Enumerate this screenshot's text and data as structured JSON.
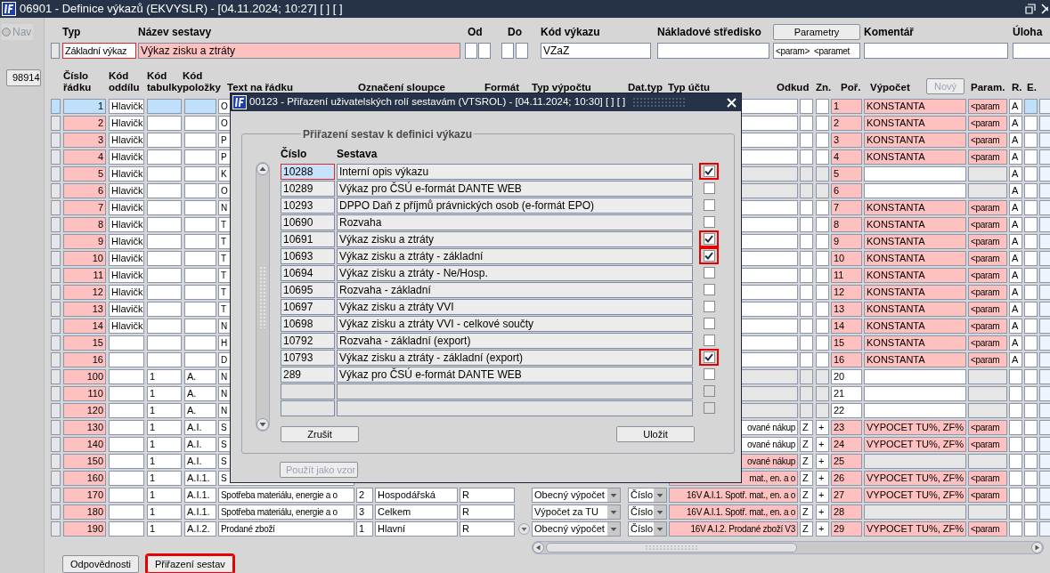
{
  "window": {
    "title": "06901 - Definice výkazů (EKVYSLR) - [04.11.2024; 10:27] [ ] [ ]"
  },
  "sidebar": {
    "nav": {
      "label": "Nav",
      "disabled": true
    },
    "record": "98914"
  },
  "form": {
    "typ": {
      "label": "Typ",
      "value": "Základní výkaz",
      "highlighted": true
    },
    "nazev": {
      "label": "Název sestavy",
      "value": "Výkaz zisku a ztráty"
    },
    "od": {
      "label": "Od"
    },
    "do": {
      "label": "Do"
    },
    "kod": {
      "label": "Kód výkazu",
      "value": "VZaZ"
    },
    "stredisko": {
      "label": "Nákladové středisko"
    },
    "parametry": {
      "button": "Parametry",
      "value": "<param>  <paramet"
    },
    "komentar": {
      "label": "Komentář"
    },
    "uloha": {
      "label": "Úloha"
    }
  },
  "table": {
    "columns": [
      "Číslo řádku",
      "Kód oddílu",
      "Kód tabulky",
      "Kód položky",
      "Text na řádku",
      "Označení sloupce",
      "Formát",
      "Typ výpočtu",
      "Dat.typ",
      "Typ účtu",
      "Odkud",
      "Zn.",
      "Poř.",
      "Výpočet",
      "Param.",
      "R.",
      "E."
    ],
    "new_button": {
      "label": "Nový",
      "disabled": true
    },
    "rows": [
      {
        "cislo": "1",
        "oddil": "Hlavičk",
        "text": "O",
        "por": "1",
        "vypocet": "KONSTANTA",
        "param": "<param",
        "r": "A",
        "selected": true,
        "disabled": false,
        "por_invalid": true,
        "uctu_invalid": false
      },
      {
        "cislo": "2",
        "oddil": "Hlavičk",
        "text": "O",
        "por": "2",
        "vypocet": "KONSTANTA",
        "param": "<param",
        "r": "A",
        "selected": false,
        "disabled": false,
        "por_invalid": true,
        "uctu_invalid": false
      },
      {
        "cislo": "3",
        "oddil": "Hlavičk",
        "text": "P",
        "por": "3",
        "vypocet": "KONSTANTA",
        "param": "<param",
        "r": "A",
        "selected": false,
        "disabled": false,
        "por_invalid": true,
        "uctu_invalid": false
      },
      {
        "cislo": "4",
        "oddil": "Hlavičk",
        "text": "P",
        "por": "4",
        "vypocet": "KONSTANTA",
        "param": "<param",
        "r": "A",
        "selected": false,
        "disabled": false,
        "por_invalid": true,
        "uctu_invalid": false
      },
      {
        "cislo": "5",
        "oddil": "Hlavičk",
        "text": "K",
        "por": "5",
        "r": "A",
        "selected": false,
        "disabled": true,
        "por_invalid": true
      },
      {
        "cislo": "6",
        "oddil": "Hlavičk",
        "text": "O",
        "por": "6",
        "r": "A",
        "selected": false,
        "disabled": true,
        "por_invalid": true
      },
      {
        "cislo": "7",
        "oddil": "Hlavičk",
        "text": "N",
        "por": "7",
        "vypocet": "KONSTANTA",
        "param": "<param",
        "r": "A",
        "selected": false,
        "disabled": false,
        "por_invalid": true,
        "uctu_invalid": false
      },
      {
        "cislo": "8",
        "oddil": "Hlavičk",
        "text": "T",
        "por": "8",
        "vypocet": "KONSTANTA",
        "param": "<param",
        "r": "A",
        "selected": false,
        "disabled": false,
        "por_invalid": true,
        "uctu_invalid": false
      },
      {
        "cislo": "9",
        "oddil": "Hlavičk",
        "text": "T",
        "por": "9",
        "vypocet": "KONSTANTA",
        "param": "<param",
        "r": "A",
        "selected": false,
        "disabled": false,
        "por_invalid": true,
        "uctu_invalid": false
      },
      {
        "cislo": "10",
        "oddil": "Hlavičk",
        "text": "T",
        "por": "10",
        "vypocet": "KONSTANTA",
        "param": "<param",
        "r": "A",
        "selected": false,
        "disabled": false,
        "por_invalid": true,
        "uctu_invalid": false
      },
      {
        "cislo": "11",
        "oddil": "Hlavičk",
        "text": "T",
        "por": "11",
        "vypocet": "KONSTANTA",
        "param": "<param",
        "r": "A",
        "selected": false,
        "disabled": false,
        "por_invalid": true,
        "uctu_invalid": false
      },
      {
        "cislo": "12",
        "oddil": "Hlavičk",
        "text": "T",
        "por": "12",
        "vypocet": "KONSTANTA",
        "param": "<param",
        "r": "A",
        "selected": false,
        "disabled": false,
        "por_invalid": true,
        "uctu_invalid": false
      },
      {
        "cislo": "13",
        "oddil": "Hlavičk",
        "text": "T",
        "por": "13",
        "vypocet": "KONSTANTA",
        "param": "<param",
        "r": "A",
        "selected": false,
        "disabled": false,
        "por_invalid": true,
        "uctu_invalid": false
      },
      {
        "cislo": "14",
        "oddil": "Hlavičk",
        "text": "N",
        "por": "14",
        "vypocet": "KONSTANTA",
        "param": "<param",
        "r": "A",
        "selected": false,
        "disabled": false,
        "por_invalid": true,
        "uctu_invalid": false
      },
      {
        "cislo": "15",
        "text": "H",
        "por": "15",
        "vypocet": "KONSTANTA",
        "param": "<param",
        "r": "A",
        "selected": false,
        "disabled": false,
        "por_invalid": true,
        "uctu_invalid": false
      },
      {
        "cislo": "16",
        "text": "D",
        "por": "16",
        "vypocet": "KONSTANTA",
        "param": "<param",
        "r": "A",
        "selected": false,
        "disabled": false,
        "por_invalid": true,
        "uctu_invalid": false
      },
      {
        "cislo": "100",
        "tabulka": "1",
        "polozka": "A.",
        "text": "N",
        "por": "20",
        "selected": false,
        "disabled": true,
        "por_invalid": false
      },
      {
        "cislo": "110",
        "tabulka": "1",
        "polozka": "A.",
        "text": "N",
        "por": "21",
        "selected": false,
        "disabled": true,
        "por_invalid": false
      },
      {
        "cislo": "120",
        "tabulka": "1",
        "polozka": "A.",
        "text": "N",
        "por": "22",
        "selected": false,
        "disabled": true,
        "por_invalid": false
      },
      {
        "cislo": "130",
        "tabulka": "1",
        "polozka": "A.I.",
        "text": "S",
        "typ_uctu": "ované nákup",
        "odkud": "Z",
        "zn": "+",
        "por": "23",
        "vypocet": "VYPOCET TU%, ZF%",
        "param": "<param",
        "selected": false,
        "disabled": false,
        "por_invalid": true,
        "uctu_invalid": false
      },
      {
        "cislo": "140",
        "tabulka": "1",
        "polozka": "A.I.",
        "text": "S",
        "typ_uctu": "ované nákup",
        "odkud": "Z",
        "zn": "+",
        "por": "24",
        "vypocet": "VYPOCET TU%, ZF%",
        "param": "<param",
        "selected": false,
        "disabled": false,
        "por_invalid": true,
        "uctu_invalid": false
      },
      {
        "cislo": "150",
        "tabulka": "1",
        "polozka": "A.I.",
        "text": "S",
        "typ_uctu": "ované nákup",
        "odkud": "Z",
        "zn": "+",
        "por": "25",
        "selected": false,
        "disabled": false,
        "por_invalid": true,
        "uctu_invalid": true
      },
      {
        "cislo": "160",
        "tabulka": "1",
        "polozka": "A.I.1.",
        "text": "S",
        "typ_uctu": "mat., en. a o",
        "odkud": "Z",
        "zn": "+",
        "por": "26",
        "vypocet": "VYPOCET TU%, ZF%",
        "param": "<param",
        "selected": false,
        "disabled": false,
        "por_invalid": true,
        "uctu_invalid": true
      },
      {
        "cislo": "170",
        "tabulka": "1",
        "polozka": "A.I.1.",
        "text": "Spotřeba materiálu, energie a o",
        "sloupec": "2",
        "sloupec_nazev": "Hospodářská",
        "format": "R",
        "typ_vypoctu": "Obecný výpočet",
        "dat_typ": "Číslo",
        "typ_uctu": "16V A.I.1. Spotř. mat., en. a o",
        "odkud": "Z",
        "zn": "+",
        "por": "27",
        "vypocet": "VYPOCET TU%, ZF%",
        "param": "<param",
        "selected": false,
        "disabled": false,
        "por_invalid": true,
        "uctu_invalid": true
      },
      {
        "cislo": "180",
        "tabulka": "1",
        "polozka": "A.I.1.",
        "text": "Spotřeba materiálu, energie a o",
        "sloupec": "3",
        "sloupec_nazev": "Celkem",
        "format": "R",
        "typ_vypoctu": "Výpočet za TU",
        "dat_typ": "Číslo",
        "typ_uctu": "16V A.I.1. Spotř. mat., en. a o",
        "odkud": "Z",
        "zn": "+",
        "por": "28",
        "selected": false,
        "disabled": false,
        "por_invalid": true,
        "uctu_invalid": true
      },
      {
        "cislo": "190",
        "tabulka": "1",
        "polozka": "A.I.2.",
        "text": "Prodané zboží",
        "sloupec": "1",
        "sloupec_nazev": "Hlavní",
        "format": "R",
        "typ_vypoctu": "Obecný výpočet",
        "dat_typ": "Číslo",
        "typ_uctu": "16V A.I.2. Prodané zboží V3",
        "odkud": "Z",
        "zn": "+",
        "por": "29",
        "vypocet": "VYPOCET TU%, ZF%",
        "param": "<param",
        "selected": false,
        "disabled": false,
        "por_invalid": true,
        "uctu_invalid": true
      }
    ]
  },
  "dialog": {
    "title": "00123 - Přiřazení uživatelských rolí sestavám (VTSROL) - [04.11.2024; 10:30] [ ] [ ]",
    "group": "Přiřazení sestav k definici výkazu",
    "columns": [
      "Číslo",
      "Sestava"
    ],
    "rows": [
      {
        "cislo": "10288",
        "sestava": "Interní opis výkazu",
        "checked": true,
        "selected": true,
        "disabled": false
      },
      {
        "cislo": "10289",
        "sestava": "Výkaz pro ČSÚ e-formát DANTE WEB",
        "checked": false,
        "selected": false,
        "disabled": false
      },
      {
        "cislo": "10293",
        "sestava": "DPPO Daň z příjmů právnických osob (e-formát EPO)",
        "checked": false,
        "selected": false,
        "disabled": false
      },
      {
        "cislo": "10690",
        "sestava": "Rozvaha",
        "checked": false,
        "selected": false,
        "disabled": false
      },
      {
        "cislo": "10691",
        "sestava": "Výkaz zisku a ztráty",
        "checked": true,
        "selected": false,
        "disabled": false
      },
      {
        "cislo": "10693",
        "sestava": "Výkaz zisku a ztráty - základní",
        "checked": true,
        "selected": false,
        "disabled": false
      },
      {
        "cislo": "10694",
        "sestava": "Výkaz zisku a ztráty - Ne/Hosp.",
        "checked": false,
        "selected": false,
        "disabled": false
      },
      {
        "cislo": "10695",
        "sestava": "Rozvaha - základní",
        "checked": false,
        "selected": false,
        "disabled": false
      },
      {
        "cislo": "10697",
        "sestava": "Výkaz zisku a ztráty VVI",
        "checked": false,
        "selected": false,
        "disabled": false
      },
      {
        "cislo": "10698",
        "sestava": "Výkaz zisku a ztráty VVI - celkové součty",
        "checked": false,
        "selected": false,
        "disabled": false
      },
      {
        "cislo": "10792",
        "sestava": "Rozvaha - základní (export)",
        "checked": false,
        "selected": false,
        "disabled": false
      },
      {
        "cislo": "10793",
        "sestava": "Výkaz zisku a ztráty - základní (export)",
        "checked": true,
        "selected": false,
        "disabled": false
      },
      {
        "cislo": "289",
        "sestava": "Výkaz pro ČSÚ e-formát DANTE WEB",
        "checked": false,
        "selected": false,
        "disabled": false
      },
      {
        "checked": false,
        "selected": false,
        "disabled": true
      },
      {
        "checked": false,
        "selected": false,
        "disabled": true
      }
    ],
    "buttons": [
      "Zrušit",
      "Uložit"
    ],
    "template_button": {
      "label": "Použít jako vzor",
      "disabled": true
    }
  },
  "buttons": [
    {
      "label": "Odpovědnosti",
      "highlighted": false
    },
    {
      "label": "Přiřazení sestav",
      "highlighted": true
    }
  ]
}
